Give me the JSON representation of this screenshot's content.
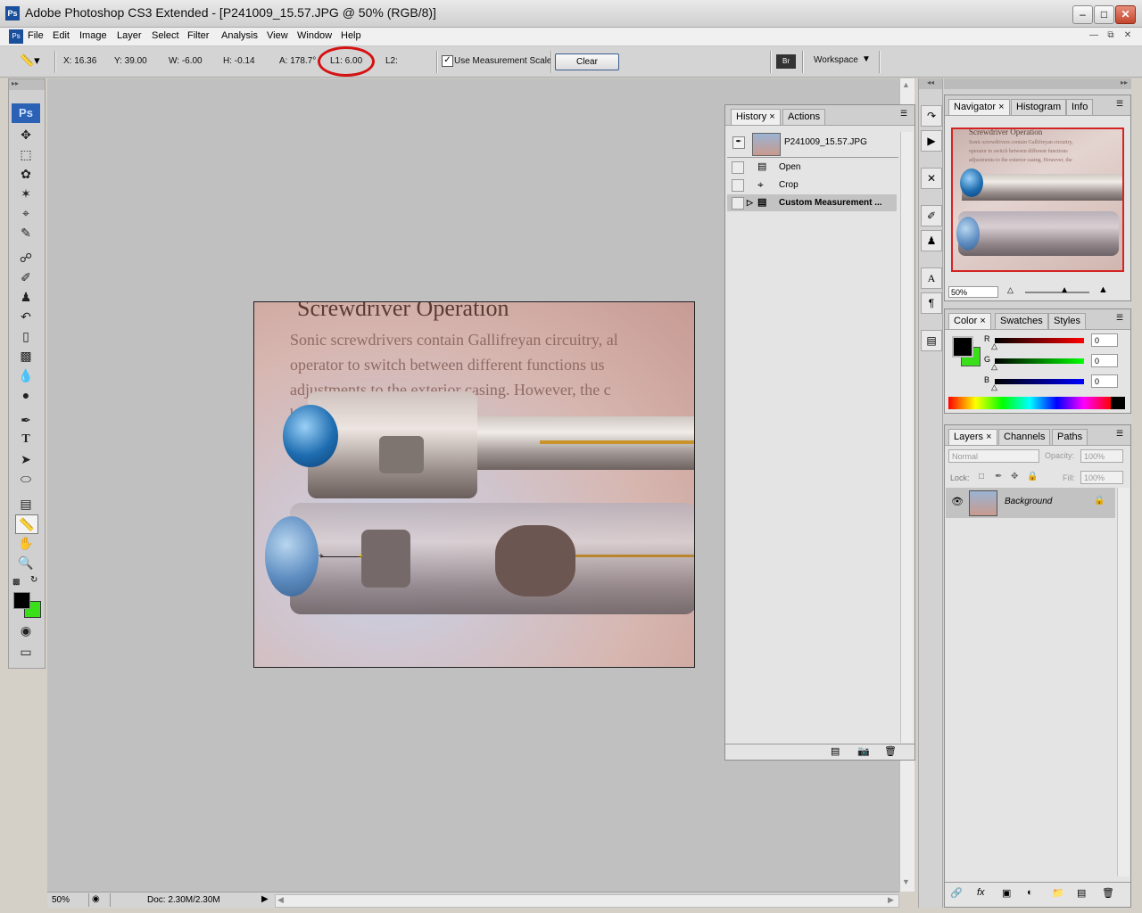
{
  "window": {
    "title": "Adobe Photoshop CS3 Extended - [P241009_15.57.JPG @ 50% (RGB/8)]",
    "app_icon": "Ps",
    "min": "‒",
    "max": "□",
    "close": "✕"
  },
  "menu": [
    "File",
    "Edit",
    "Image",
    "Layer",
    "Select",
    "Filter",
    "Analysis",
    "View",
    "Window",
    "Help"
  ],
  "options": {
    "x": "X: 16.36",
    "y": "Y: 39.00",
    "w": "W: -6.00",
    "h": "H: -0.14",
    "a": "A: 178.7°",
    "l1": "L1: 6.00",
    "l2": "L2:",
    "use_scale_label": "Use Measurement Scale",
    "use_scale_checked": true,
    "clear": "Clear",
    "workspace": "Workspace"
  },
  "document": {
    "heading": "Screwdriver Operation",
    "lines": [
      "Sonic screwdrivers contain Gallifreyan circuitry, al",
      "operator to switch between different functions us",
      "adjustments to the exterior casing. However, the c",
      "ba                            bject for maximum effe"
    ]
  },
  "status": {
    "zoom": "50%",
    "doc": "Doc: 2.30M/2.30M"
  },
  "history": {
    "tabs": [
      "History",
      "Actions"
    ],
    "snapshot": "P241009_15.57.JPG",
    "items": [
      "Open",
      "Crop",
      "Custom Measurement ..."
    ]
  },
  "navigator": {
    "tabs": [
      "Navigator",
      "Histogram",
      "Info"
    ],
    "zoom": "50%",
    "thumb_heading": "Screwdriver Operation",
    "thumb_lines": [
      "Sonic screwdrivers contain Gallifreyan circuitry,",
      "operator to switch between different functions",
      "adjustments to the exterior casing. However, the"
    ]
  },
  "color": {
    "tabs": [
      "Color",
      "Swatches",
      "Styles"
    ],
    "r_label": "R",
    "g_label": "G",
    "b_label": "B",
    "r": "0",
    "g": "0",
    "b": "0",
    "foreground": "#000000",
    "background": "#39e01a"
  },
  "layers": {
    "tabs": [
      "Layers",
      "Channels",
      "Paths"
    ],
    "blend": "Normal",
    "opacity_label": "Opacity:",
    "opacity": "100%",
    "lock_label": "Lock:",
    "fill_label": "Fill:",
    "fill": "100%",
    "layer_name": "Background"
  },
  "toolbox": {
    "logo": "Ps",
    "icons": [
      "move-icon",
      "marquee-icon",
      "lasso-icon",
      "magic-wand-icon",
      "crop-icon",
      "eyedropper-icon",
      "healing-brush-icon",
      "brush-icon",
      "clone-stamp-icon",
      "history-brush-icon",
      "eraser-icon",
      "gradient-icon",
      "blur-icon",
      "dodge-icon",
      "pen-icon",
      "type-icon",
      "path-select-icon",
      "shape-icon",
      "notes-icon",
      "ruler-icon",
      "hand-icon",
      "zoom-icon"
    ],
    "foreground": "#000000",
    "background": "#39e01a"
  }
}
